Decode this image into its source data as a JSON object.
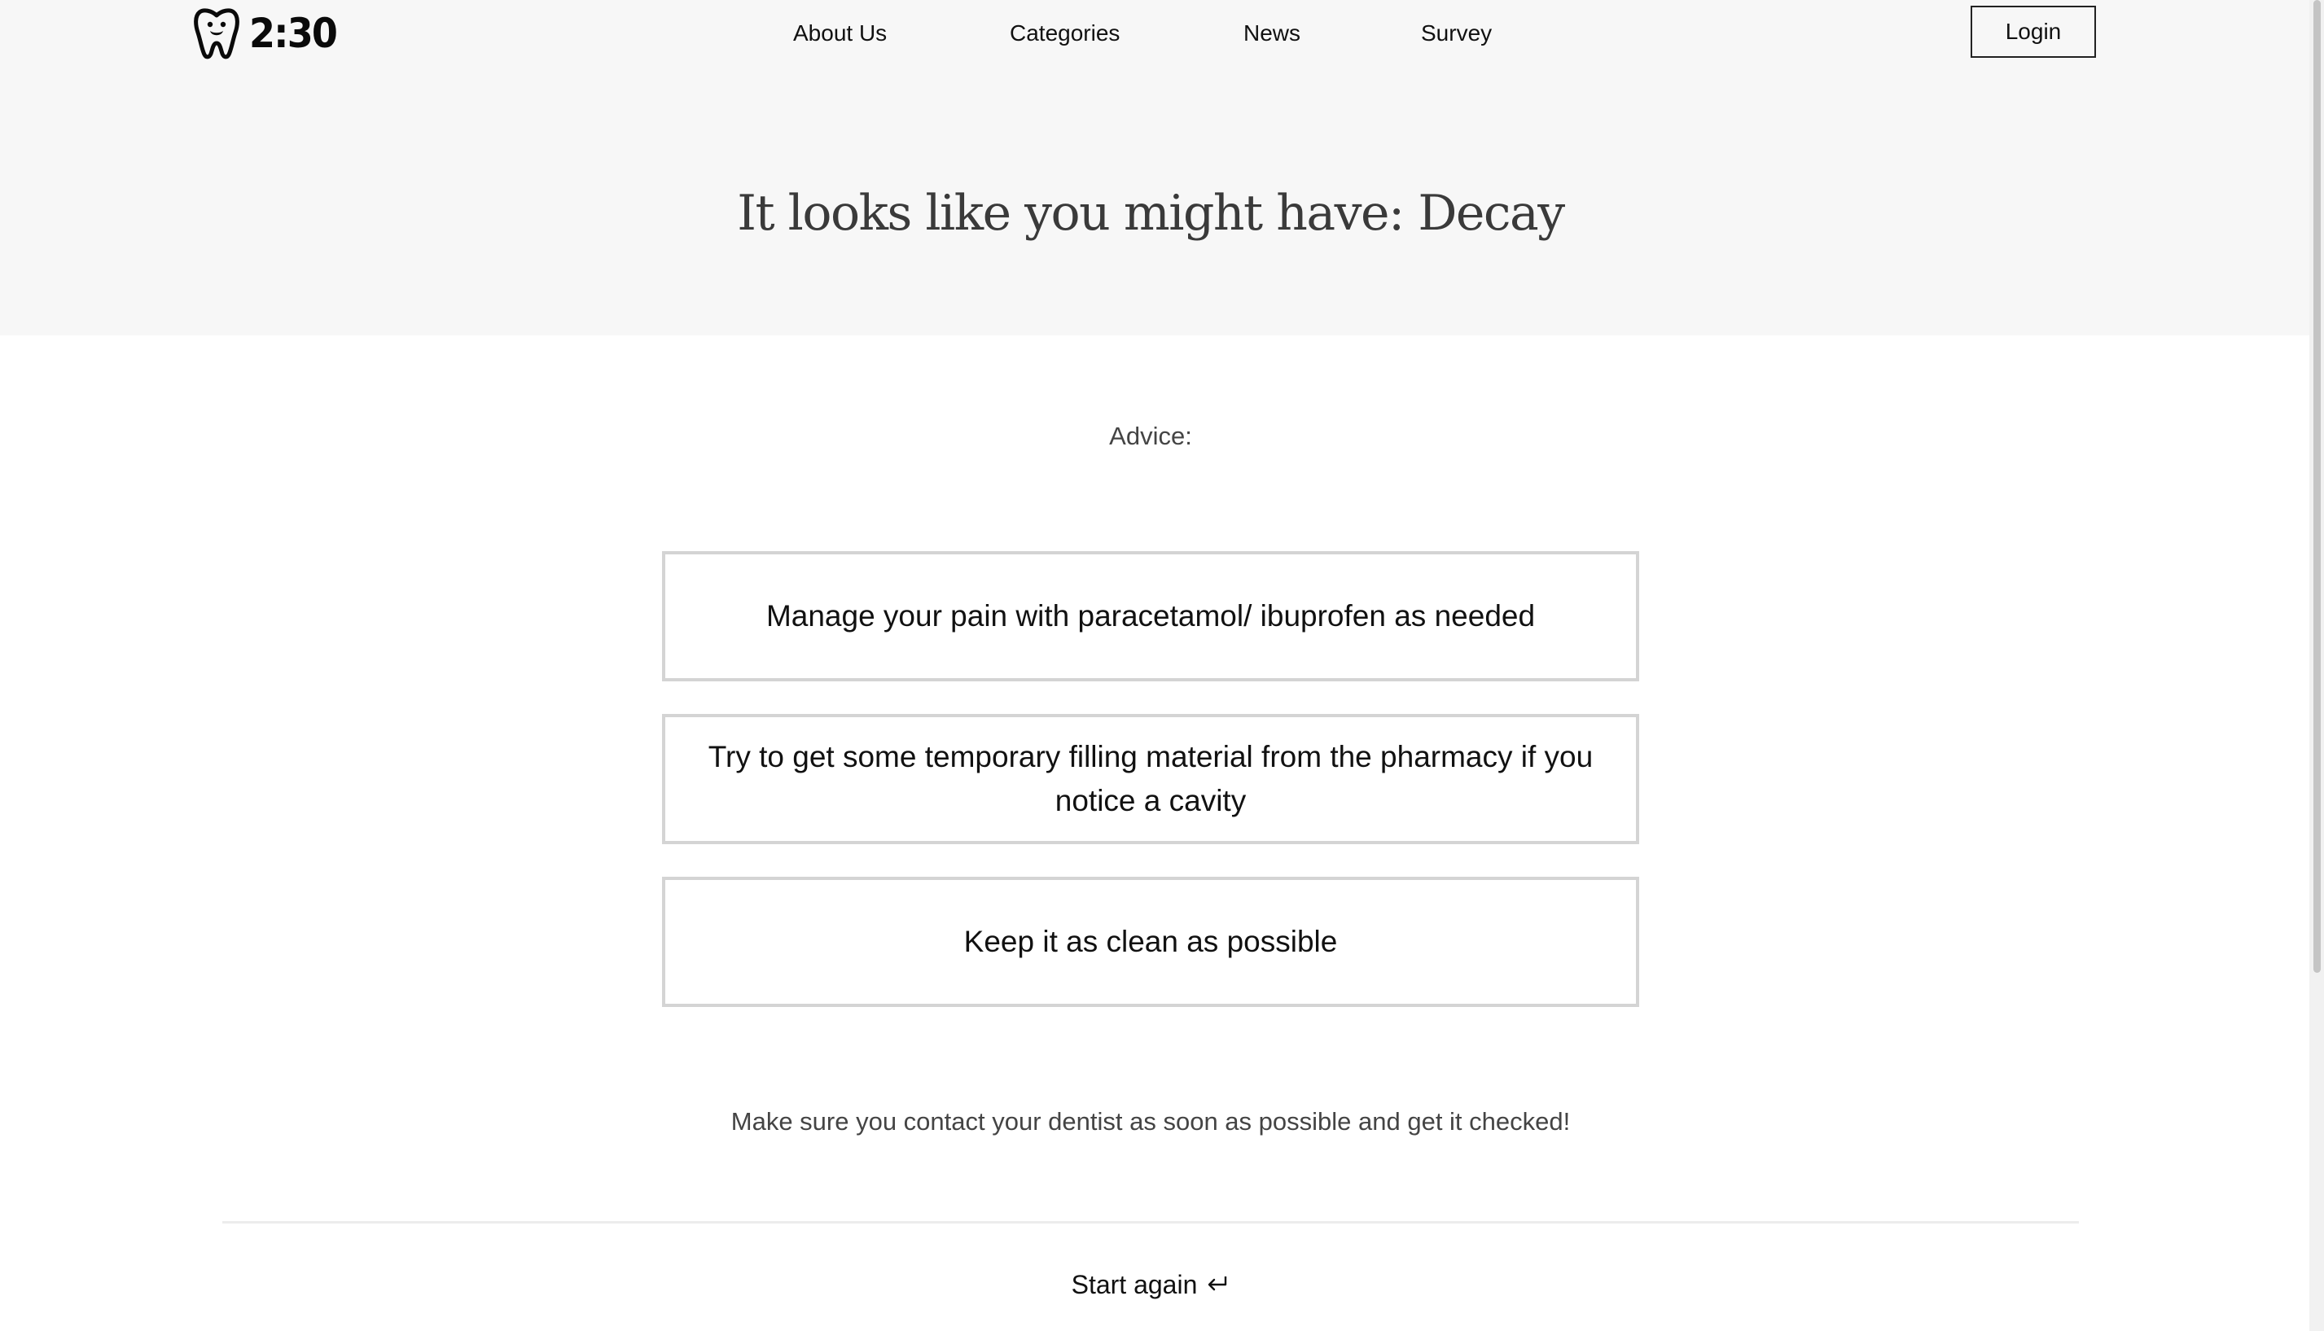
{
  "header": {
    "logo_text": "2:30",
    "logo_icon": "tooth-icon",
    "nav": [
      {
        "label": "About Us"
      },
      {
        "label": "Categories"
      },
      {
        "label": "News"
      },
      {
        "label": "Survey"
      }
    ],
    "login_label": "Login"
  },
  "hero": {
    "title": "It looks like you might have: Decay"
  },
  "advice": {
    "label": "Advice:",
    "items": [
      {
        "text": "Manage your pain with paracetamol/ ibuprofen as needed"
      },
      {
        "text": "Try to get some temporary filling material from the pharmacy if you notice a cavity"
      },
      {
        "text": "Keep it as clean as possible"
      }
    ]
  },
  "contact_note": "Make sure you contact your dentist as soon as possible and get it checked!",
  "start_again": {
    "label": "Start again",
    "icon": "return-arrow-icon"
  },
  "colors": {
    "hero_bg": "#f7f7f7",
    "card_border": "#d4d4d4",
    "title_text": "#3a3a3a",
    "body_text": "#444444"
  }
}
